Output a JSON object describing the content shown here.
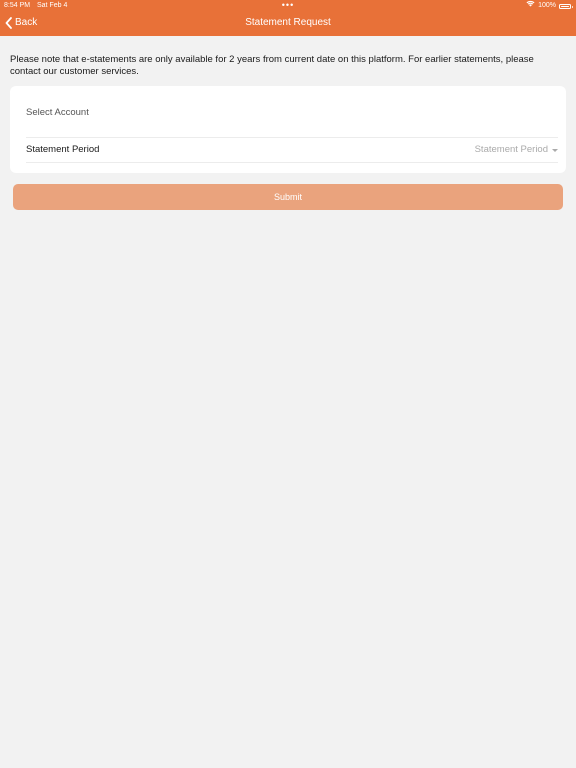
{
  "status_bar": {
    "time": "8:54 PM",
    "date": "Sat Feb 4",
    "multitask_dots": "•••",
    "battery": "100%",
    "icons": [
      "wifi-icon",
      "battery-icon"
    ]
  },
  "nav_bar": {
    "back_label": "Back",
    "title": "Statement Request",
    "color": "#e87138"
  },
  "notice": "Please note that e-statements are only available for 2 years from current date on this platform. For earlier statements, please contact our customer services.",
  "form": {
    "account_placeholder": "Select Account",
    "period_label": "Statement Period",
    "period_value": "Statement Period"
  },
  "submit_label": "Submit",
  "colors": {
    "accent": "#e87138",
    "submit_disabled": "#eaa37d",
    "background": "#f2f2f2"
  }
}
